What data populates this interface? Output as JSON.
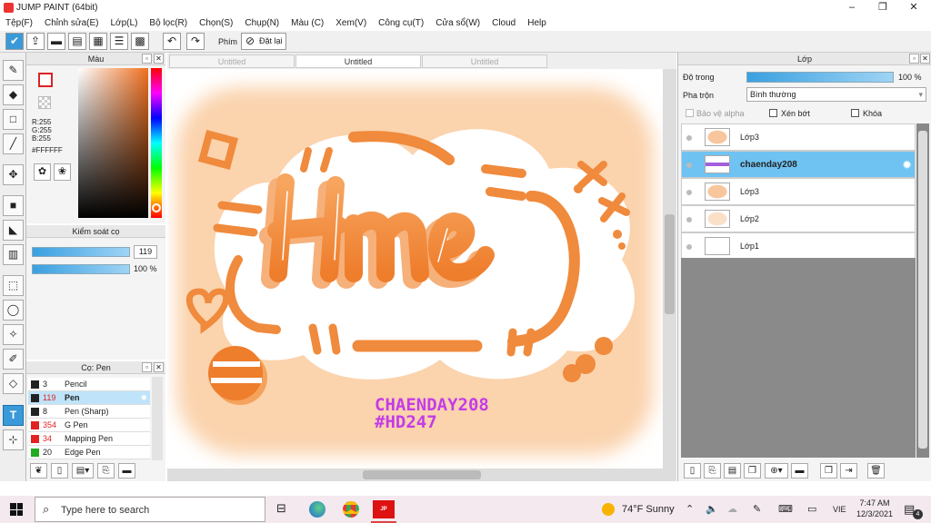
{
  "window": {
    "title": "JUMP PAINT (64bit)",
    "minimize": "–",
    "restore": "❐",
    "close": "✕"
  },
  "menu": [
    "Tệp(F)",
    "Chỉnh sửa(E)",
    "Lớp(L)",
    "Bộ lọc(R)",
    "Chọn(S)",
    "Chụp(N)",
    "Màu (C)",
    "Xem(V)",
    "Công cụ(T)",
    "Cửa sổ(W)",
    "Cloud",
    "Help"
  ],
  "toolbar": {
    "key_label": "Phím",
    "reset_label": "Đặt lại"
  },
  "color_panel": {
    "title": "Màu",
    "r": "R:255",
    "g": "G:255",
    "b": "B:255",
    "hex": "#FFFFFF"
  },
  "brush_control": {
    "title": "Kiểm soát cọ",
    "size": "119",
    "opacity": "100 %"
  },
  "brush_list": {
    "title": "Cọ: Pen",
    "items": [
      {
        "num": "3",
        "name": "Pencil",
        "color": "#222222"
      },
      {
        "num": "119",
        "name": "Pen",
        "color": "#222222"
      },
      {
        "num": "8",
        "name": "Pen (Sharp)",
        "color": "#222222"
      },
      {
        "num": "354",
        "name": "G Pen",
        "color": "#e22222"
      },
      {
        "num": "34",
        "name": "Mapping Pen",
        "color": "#e22222"
      },
      {
        "num": "20",
        "name": "Edge Pen",
        "color": "#22aa22"
      }
    ]
  },
  "tabs": [
    "Untitled",
    "Untitled",
    "Untitled"
  ],
  "canvas": {
    "logo": "Hme",
    "credit1": "CHAENDAY208",
    "credit2": "#HD247"
  },
  "layer_panel": {
    "title": "Lớp",
    "opacity_label": "Độ trong",
    "opacity_value": "100 %",
    "blend_label": "Pha trộn",
    "blend_value": "Bình thường",
    "protect_alpha": "Bảo vệ alpha",
    "clip": "Xén bớt",
    "lock": "Khóa",
    "layers": [
      {
        "name": "Lớp3"
      },
      {
        "name": "chaenday208"
      },
      {
        "name": "Lớp3"
      },
      {
        "name": "Lớp2"
      },
      {
        "name": "Lớp1"
      }
    ]
  },
  "taskbar": {
    "search_placeholder": "Type here to search",
    "weather": "74°F  Sunny",
    "lang": "VIE",
    "time": "7:47 AM",
    "date": "12/3/2021",
    "notif_count": "4"
  }
}
